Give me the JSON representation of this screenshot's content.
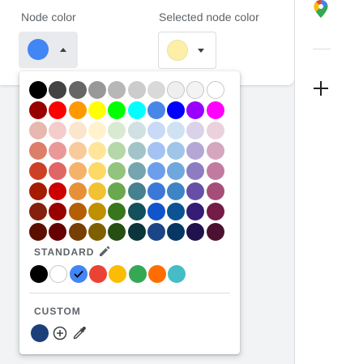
{
  "settings": {
    "node_color_label": "Node color",
    "selected_node_color_label": "Selected node color",
    "node_color_value": "#4285f4",
    "selected_node_color_value": "#fdefa8"
  },
  "sidebar": {
    "icons": [
      "google-maps-icon",
      "plus-icon"
    ]
  },
  "color_picker": {
    "palette": [
      [
        "#000000",
        "#434343",
        "#666666",
        "#999999",
        "#b7b7b7",
        "#cccccc",
        "#d9d9d9",
        "#efefef",
        "#f3f3f3",
        "#ffffff"
      ],
      [
        "#980000",
        "#ff0000",
        "#ff9900",
        "#ffff00",
        "#00ff00",
        "#00ffff",
        "#4a86e8",
        "#0000ff",
        "#9900ff",
        "#ff00ff"
      ],
      [
        "#e6b8af",
        "#f4cccc",
        "#fce5cd",
        "#fff2cc",
        "#d9ead3",
        "#d0e0e3",
        "#c9daf8",
        "#cfe2f3",
        "#d9d2e9",
        "#ead1dc"
      ],
      [
        "#dd7e6b",
        "#ea9999",
        "#f9cb9c",
        "#ffe599",
        "#b6d7a8",
        "#a2c4c9",
        "#a4c2f4",
        "#9fc5e8",
        "#b4a7d6",
        "#d5a6bd"
      ],
      [
        "#cc4125",
        "#e06666",
        "#f6b26b",
        "#ffd966",
        "#93c47d",
        "#76a5af",
        "#6d9eeb",
        "#6fa8dc",
        "#8e7cc3",
        "#c27ba0"
      ],
      [
        "#a61c00",
        "#cc0000",
        "#e69138",
        "#f1c232",
        "#6aa84f",
        "#45818e",
        "#3c78d8",
        "#3d85c6",
        "#674ea7",
        "#a64d79"
      ],
      [
        "#85200c",
        "#990000",
        "#b45f06",
        "#bf9000",
        "#38761d",
        "#134f5c",
        "#1155cc",
        "#0b5394",
        "#351c75",
        "#741b47"
      ],
      [
        "#5b0f00",
        "#660000",
        "#783f04",
        "#7f6000",
        "#274e13",
        "#0c343d",
        "#1c4587",
        "#073763",
        "#20124d",
        "#4c1130"
      ]
    ],
    "standard_title": "STANDARD",
    "standard": [
      "#000000",
      "#ffffff",
      "#4285f4",
      "#ea4335",
      "#fbbc04",
      "#34a853",
      "#ff6d01",
      "#46bdc6"
    ],
    "standard_selected_index": 2,
    "custom_title": "CUSTOM",
    "custom": [
      "#1c3f7a"
    ]
  }
}
